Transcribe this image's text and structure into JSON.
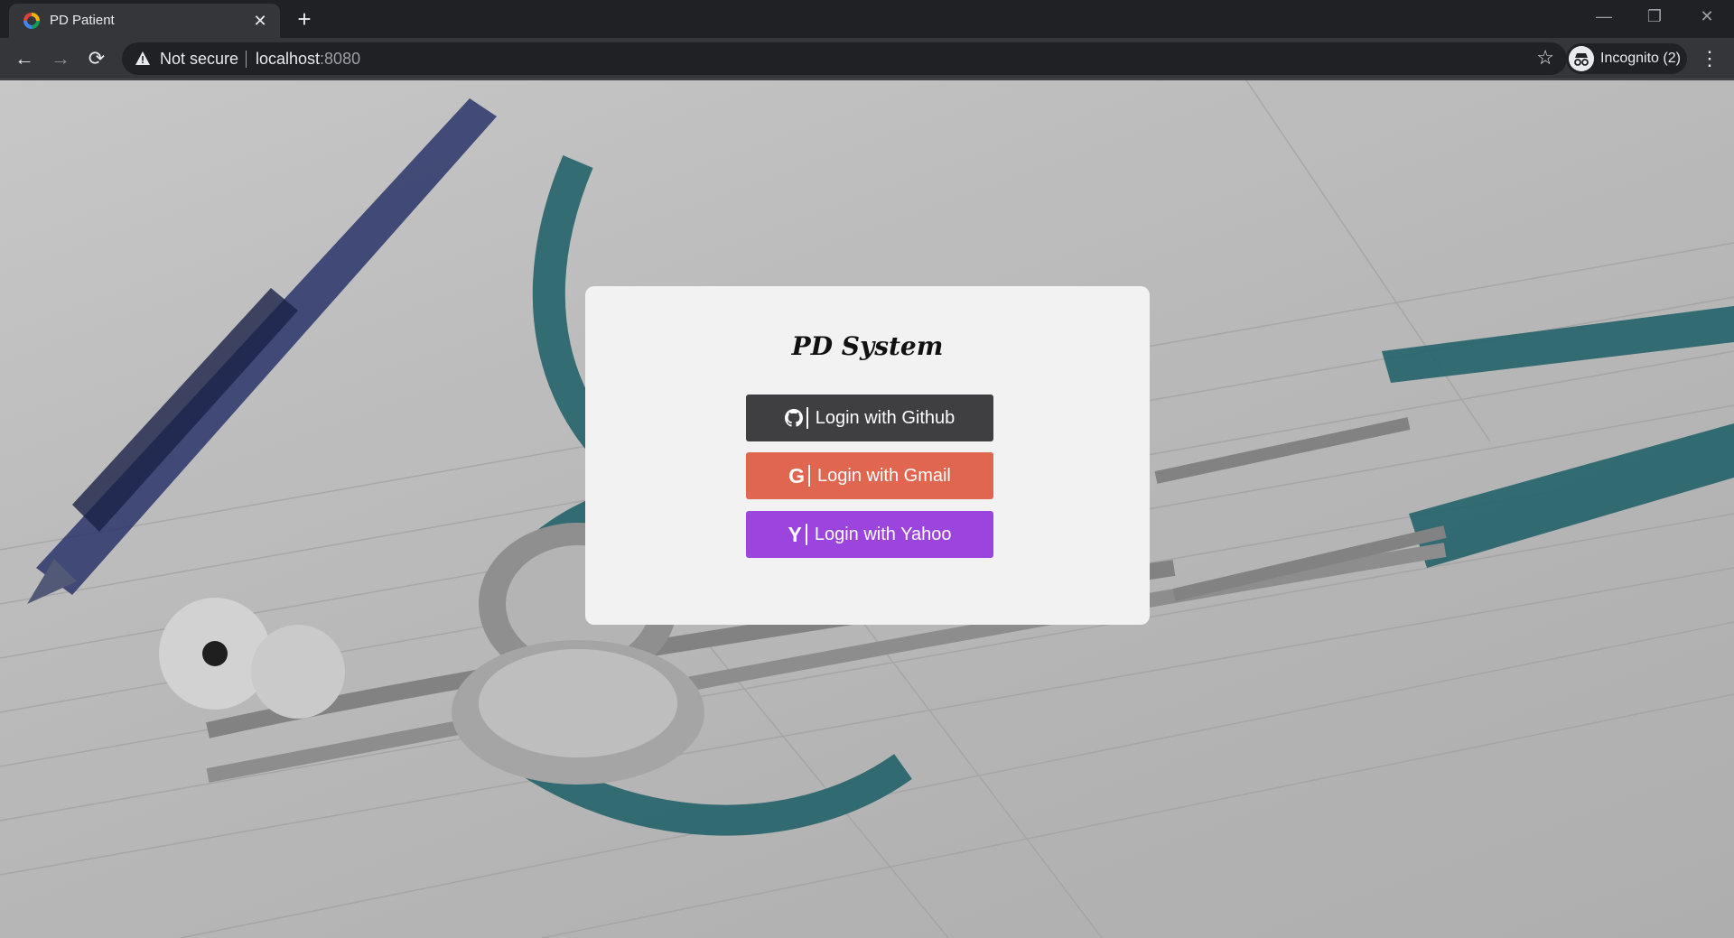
{
  "browser": {
    "tab_title": "PD Patient",
    "tab_close": "✕",
    "new_tab": "+",
    "window_controls": {
      "minimize": "—",
      "restore": "❐",
      "close": "✕"
    },
    "nav": {
      "back": "←",
      "forward": "→",
      "reload": "⟳"
    },
    "security_label": "Not secure",
    "url_host": "localhost",
    "url_port": ":8080",
    "bookmark_icon": "☆",
    "incognito_label": "Incognito (2)",
    "menu_icon": "⋮"
  },
  "page": {
    "title": "PD System",
    "buttons": {
      "github": {
        "icon": "github-icon",
        "label": "Login with Github",
        "color": "#3f3f42"
      },
      "gmail": {
        "icon": "G",
        "label": "Login with Gmail",
        "color": "#e16650"
      },
      "yahoo": {
        "icon": "Y",
        "label": "Login with Yahoo",
        "color": "#9c45de"
      }
    }
  }
}
